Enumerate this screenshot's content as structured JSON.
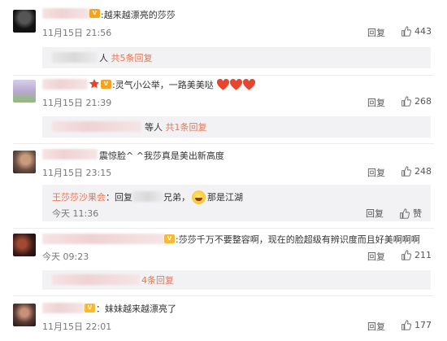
{
  "actions": {
    "reply_label": "回复",
    "like_label": "赞"
  },
  "comments": [
    {
      "text": ":越来越漂亮的莎莎",
      "time": "11月15日 21:56",
      "likes": "443",
      "replies_summary": {
        "suffix": "人",
        "link": "共5条回复"
      }
    },
    {
      "text": ":灵气小公举，一路美美哒",
      "time": "11月15日 21:39",
      "likes": "268",
      "replies_summary": {
        "suffix": "等人",
        "link": "共1条回复"
      }
    },
    {
      "text": "震惊脸^ ^我莎真是美出新高度",
      "time": "11月15日 23:15",
      "likes": "248",
      "sub_reply": {
        "author": "王莎莎沙果会",
        "prefix": "：回复",
        "mid": "兄弟，",
        "after": "那是江湖",
        "time": "今天 11:36"
      }
    },
    {
      "text": ":莎莎千万不要整容啊，现在的脸超级有辨识度而且好美啊啊啊",
      "time": "今天 09:23",
      "likes": "211",
      "replies_summary": {
        "suffix": "4条回复",
        "link": ""
      }
    },
    {
      "text": "：妹妹越来越漂亮了",
      "time": "11月15日 22:01",
      "likes": "177"
    }
  ],
  "colors": {
    "link": "#eb7350",
    "panel": "#f2f2f5",
    "heart": "#e8442e"
  }
}
